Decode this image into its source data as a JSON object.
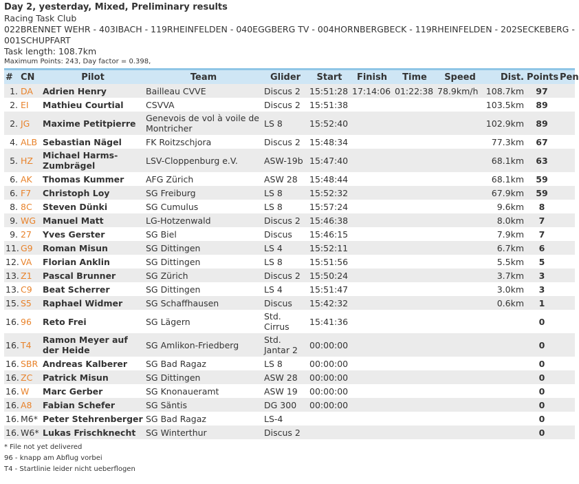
{
  "header": {
    "title": "Day 2, yesterday, Mixed, Preliminary results",
    "club": "Racing Task Club",
    "route": "022BRENNET WEHR - 403IBACH - 119RHEINFELDEN - 040EGGBERG TV - 004HORNBERGBECK - 119RHEINFELDEN - 202SECKEBERG - 001SCHUPFART",
    "task_length": "Task length: 108.7km",
    "max_points": "Maximum Points: 243, Day factor = 0.398,"
  },
  "columns": [
    "#",
    "CN",
    "Pilot",
    "Team",
    "Glider",
    "Start",
    "Finish",
    "Time",
    "Speed",
    "Dist.",
    "Points",
    "Pen."
  ],
  "rows": [
    {
      "rank": "1.",
      "cn": "DA",
      "pilot": "Adrien Henry",
      "team": "Bailleau CVVE",
      "glider": "Discus 2",
      "start": "15:51:28",
      "finish": "17:14:06",
      "time": "01:22:38",
      "speed": "78.9km/h",
      "dist": "108.7km",
      "points": "97",
      "pen": ""
    },
    {
      "rank": "2.",
      "cn": "EI",
      "pilot": "Mathieu Courtial",
      "team": "CSVVA",
      "glider": "Discus 2",
      "start": "15:51:38",
      "finish": "",
      "time": "",
      "speed": "",
      "dist": "103.5km",
      "points": "89",
      "pen": ""
    },
    {
      "rank": "2.",
      "cn": "JG",
      "pilot": "Maxime Petitpierre",
      "team": "Genevois de vol à voile de Montricher",
      "glider": "LS 8",
      "start": "15:52:40",
      "finish": "",
      "time": "",
      "speed": "",
      "dist": "102.9km",
      "points": "89",
      "pen": "",
      "tall": true
    },
    {
      "rank": "4.",
      "cn": "ALB",
      "pilot": "Sebastian Nägel",
      "team": "FK Roitzschjora",
      "glider": "Discus 2",
      "start": "15:48:34",
      "finish": "",
      "time": "",
      "speed": "",
      "dist": "77.3km",
      "points": "67",
      "pen": ""
    },
    {
      "rank": "5.",
      "cn": "HZ",
      "pilot": "Michael Harms-Zumbrägel",
      "team": "LSV-Cloppenburg e.V.",
      "glider": "ASW-19b",
      "start": "15:47:40",
      "finish": "",
      "time": "",
      "speed": "",
      "dist": "68.1km",
      "points": "63",
      "pen": "",
      "tall": true
    },
    {
      "rank": "6.",
      "cn": "AK",
      "pilot": "Thomas Kummer",
      "team": "AFG Zürich",
      "glider": "ASW 28",
      "start": "15:48:44",
      "finish": "",
      "time": "",
      "speed": "",
      "dist": "68.1km",
      "points": "59",
      "pen": ""
    },
    {
      "rank": "6.",
      "cn": "F7",
      "pilot": "Christoph Loy",
      "team": "SG Freiburg",
      "glider": "LS 8",
      "start": "15:52:32",
      "finish": "",
      "time": "",
      "speed": "",
      "dist": "67.9km",
      "points": "59",
      "pen": ""
    },
    {
      "rank": "8.",
      "cn": "8C",
      "pilot": "Steven Dünki",
      "team": "SG Cumulus",
      "glider": "LS 8",
      "start": "15:57:24",
      "finish": "",
      "time": "",
      "speed": "",
      "dist": "9.6km",
      "points": "8",
      "pen": ""
    },
    {
      "rank": "9.",
      "cn": "WG",
      "pilot": "Manuel Matt",
      "team": "LG-Hotzenwald",
      "glider": "Discus 2",
      "start": "15:46:38",
      "finish": "",
      "time": "",
      "speed": "",
      "dist": "8.0km",
      "points": "7",
      "pen": ""
    },
    {
      "rank": "9.",
      "cn": "27",
      "pilot": "Yves Gerster",
      "team": "SG Biel",
      "glider": "Discus",
      "start": "15:46:15",
      "finish": "",
      "time": "",
      "speed": "",
      "dist": "7.9km",
      "points": "7",
      "pen": ""
    },
    {
      "rank": "11.",
      "cn": "G9",
      "pilot": "Roman Misun",
      "team": "SG Dittingen",
      "glider": "LS 4",
      "start": "15:52:11",
      "finish": "",
      "time": "",
      "speed": "",
      "dist": "6.7km",
      "points": "6",
      "pen": ""
    },
    {
      "rank": "12.",
      "cn": "VA",
      "pilot": "Florian Anklin",
      "team": "SG Dittingen",
      "glider": "LS 8",
      "start": "15:51:56",
      "finish": "",
      "time": "",
      "speed": "",
      "dist": "5.5km",
      "points": "5",
      "pen": ""
    },
    {
      "rank": "13.",
      "cn": "Z1",
      "pilot": "Pascal Brunner",
      "team": "SG Zürich",
      "glider": "Discus 2",
      "start": "15:50:24",
      "finish": "",
      "time": "",
      "speed": "",
      "dist": "3.7km",
      "points": "3",
      "pen": ""
    },
    {
      "rank": "13.",
      "cn": "C9",
      "pilot": "Beat Scherrer",
      "team": "SG Dittingen",
      "glider": "LS 4",
      "start": "15:51:47",
      "finish": "",
      "time": "",
      "speed": "",
      "dist": "3.0km",
      "points": "3",
      "pen": ""
    },
    {
      "rank": "15.",
      "cn": "S5",
      "pilot": "Raphael Widmer",
      "team": "SG Schaffhausen",
      "glider": "Discus",
      "start": "15:42:32",
      "finish": "",
      "time": "",
      "speed": "",
      "dist": "0.6km",
      "points": "1",
      "pen": ""
    },
    {
      "rank": "16.",
      "cn": "96",
      "pilot": "Reto Frei",
      "team": "SG Lägern",
      "glider": "Std. Cirrus",
      "start": "15:41:36",
      "finish": "",
      "time": "",
      "speed": "",
      "dist": "",
      "points": "0",
      "pen": "",
      "tall": true
    },
    {
      "rank": "16.",
      "cn": "T4",
      "pilot": "Ramon Meyer auf der Heide",
      "team": "SG Amlikon-Friedberg",
      "glider": "Std. Jantar 2",
      "start": "00:00:00",
      "finish": "",
      "time": "",
      "speed": "",
      "dist": "",
      "points": "0",
      "pen": "",
      "tall": true
    },
    {
      "rank": "16.",
      "cn": "SBR",
      "pilot": "Andreas Kalberer",
      "team": "SG Bad Ragaz",
      "glider": "LS 8",
      "start": "00:00:00",
      "finish": "",
      "time": "",
      "speed": "",
      "dist": "",
      "points": "0",
      "pen": ""
    },
    {
      "rank": "16.",
      "cn": "ZC",
      "pilot": "Patrick Misun",
      "team": "SG Dittingen",
      "glider": "ASW 28",
      "start": "00:00:00",
      "finish": "",
      "time": "",
      "speed": "",
      "dist": "",
      "points": "0",
      "pen": ""
    },
    {
      "rank": "16.",
      "cn": "W",
      "pilot": "Marc Gerber",
      "team": "SG Knonaueramt",
      "glider": "ASW 19",
      "start": "00:00:00",
      "finish": "",
      "time": "",
      "speed": "",
      "dist": "",
      "points": "0",
      "pen": ""
    },
    {
      "rank": "16.",
      "cn": "A8",
      "pilot": "Fabian Schefer",
      "team": "SG Säntis",
      "glider": "DG 300",
      "start": "00:00:00",
      "finish": "",
      "time": "",
      "speed": "",
      "dist": "",
      "points": "0",
      "pen": ""
    },
    {
      "rank": "16.",
      "cn": "M6*",
      "pilot": "Peter Stehrenberger",
      "team": "SG Bad Ragaz",
      "glider": "LS-4",
      "start": "",
      "finish": "",
      "time": "",
      "speed": "",
      "dist": "",
      "points": "0",
      "pen": "",
      "plain": true
    },
    {
      "rank": "16.",
      "cn": "W6*",
      "pilot": "Lukas Frischknecht",
      "team": "SG Winterthur",
      "glider": "Discus 2",
      "start": "",
      "finish": "",
      "time": "",
      "speed": "",
      "dist": "",
      "points": "0",
      "pen": "",
      "plain": true
    }
  ],
  "notes": [
    "* File not yet delivered",
    "96 - knapp am Abflug vorbei",
    "T4 - Startlinie leider nicht ueberflogen"
  ],
  "colors": {
    "cn_link": "#e8822a",
    "header_bg": "#cfe6f5",
    "header_border": "#8fc6e6",
    "row_alt": "#ebebeb"
  }
}
